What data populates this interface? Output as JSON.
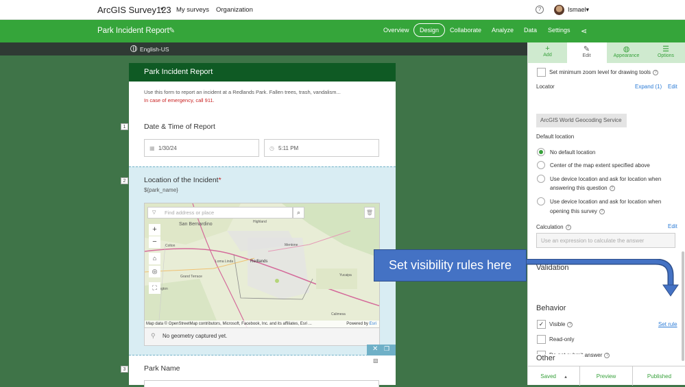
{
  "topbar": {
    "app_name": "ArcGIS Survey123",
    "caret": "▾",
    "nav": [
      "My surveys",
      "Organization"
    ],
    "help": "?",
    "user": "Ismael▾"
  },
  "survey_bar": {
    "title": "Park Incident Report",
    "tabs": [
      "Overview",
      "Design",
      "Collaborate",
      "Analyze",
      "Data",
      "Settings"
    ],
    "active_tab": "Design"
  },
  "language": "English-US",
  "form": {
    "header": "Park Incident Report",
    "description": "Use this form to report an incident at a Redlands Park. Fallen trees, trash, vandalism...",
    "emergency": "In case of emergency, call 911.",
    "q1": {
      "num": "1",
      "label": "Date & Time of Report",
      "date": "1/30/24",
      "time": "5:11 PM"
    },
    "q2": {
      "num": "2",
      "label": "Location of the Incident",
      "required_mark": "*",
      "hint": "${park_name}",
      "search_placeholder": "Find address or place",
      "attribution": "Map data © OpenStreetMap contributors, Microsoft, Facebook, Inc. and its affiliates, Esri ...",
      "powered_by": "Powered by",
      "powered_by_brand": "Esri",
      "no_geometry": "No geometry captured yet.",
      "map_labels": [
        "San Bernardino",
        "Highland",
        "Loma Linda",
        "Redlands",
        "Grand Terrace",
        "Yucaipa",
        "Calimesa",
        "Colton",
        "Mentone",
        "Bloomington"
      ]
    },
    "q3": {
      "num": "3",
      "label": "Park Name"
    }
  },
  "panel": {
    "tabs": [
      {
        "label": "Add",
        "icon": "+"
      },
      {
        "label": "Edit",
        "icon": "✎"
      },
      {
        "label": "Appearance",
        "icon": "◍"
      },
      {
        "label": "Options",
        "icon": "☰"
      }
    ],
    "min_zoom_label": "Set minimum zoom level for drawing tools",
    "locator_label": "Locator",
    "expand_label": "Expand (1)",
    "edit_label": "Edit",
    "locator_value": "ArcGIS World Geocoding Service",
    "default_location_label": "Default location",
    "locations": [
      {
        "label": "No default location",
        "selected": true
      },
      {
        "label": "Center of the map extent specified above",
        "selected": false
      },
      {
        "label_line1": "Use device location and ask for location when",
        "label_line2": "answering this question",
        "selected": false
      },
      {
        "label_line1": "Use device location and ask for location when",
        "label_line2": "opening this survey",
        "selected": false
      }
    ],
    "calculation_label": "Calculation",
    "calculation_edit": "Edit",
    "calculation_placeholder": "Use an expression to calculate the answer",
    "validation_label": "Validation",
    "behavior_label": "Behavior",
    "visible_label": "Visible",
    "visible_checked": true,
    "set_rule": "Set rule",
    "readonly_label": "Read-only",
    "no_submit_label": "Do not submit answer",
    "other_label": "Other",
    "footer": {
      "saved": "Saved",
      "preview": "Preview",
      "published": "Published"
    }
  },
  "callout": {
    "text": "Set visibility rules here",
    "color": "#4472c4"
  },
  "colors": {
    "brand_green": "#35a53a",
    "form_header": "#0f5a24",
    "canvas": "#3f7448",
    "link": "#2b7bd6"
  }
}
